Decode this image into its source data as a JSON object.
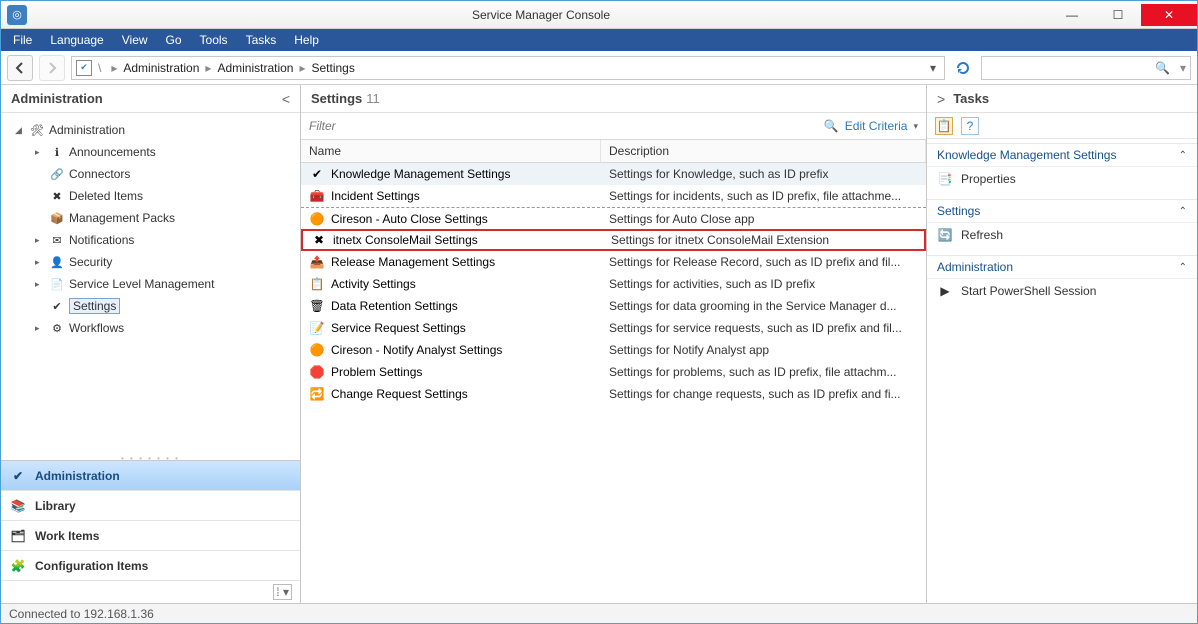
{
  "window": {
    "title": "Service Manager Console"
  },
  "menu": {
    "items": [
      "File",
      "Language",
      "View",
      "Go",
      "Tools",
      "Tasks",
      "Help"
    ]
  },
  "breadcrumb": {
    "segments": [
      "Administration",
      "Administration",
      "Settings"
    ]
  },
  "nav": {
    "title": "Administration",
    "tree": [
      {
        "label": "Administration",
        "depth": 0,
        "expander": "◢",
        "icon": "admin-root-icon"
      },
      {
        "label": "Announcements",
        "depth": 1,
        "expander": "▸",
        "icon": "announcement-icon"
      },
      {
        "label": "Connectors",
        "depth": 1,
        "expander": "",
        "icon": "connector-icon"
      },
      {
        "label": "Deleted Items",
        "depth": 1,
        "expander": "",
        "icon": "delete-icon"
      },
      {
        "label": "Management Packs",
        "depth": 1,
        "expander": "",
        "icon": "package-icon"
      },
      {
        "label": "Notifications",
        "depth": 1,
        "expander": "▸",
        "icon": "mail-icon"
      },
      {
        "label": "Security",
        "depth": 1,
        "expander": "▸",
        "icon": "user-icon"
      },
      {
        "label": "Service Level Management",
        "depth": 1,
        "expander": "▸",
        "icon": "sla-icon"
      },
      {
        "label": "Settings",
        "depth": 1,
        "expander": "",
        "icon": "settings-small-icon",
        "selected": true
      },
      {
        "label": "Workflows",
        "depth": 1,
        "expander": "▸",
        "icon": "workflow-icon"
      }
    ],
    "wunderbar": [
      {
        "label": "Administration",
        "active": true
      },
      {
        "label": "Library"
      },
      {
        "label": "Work Items"
      },
      {
        "label": "Configuration Items"
      }
    ]
  },
  "grid": {
    "title": "Settings",
    "count": "11",
    "filter_placeholder": "Filter",
    "edit_criteria": "Edit Criteria",
    "columns": [
      "Name",
      "Description"
    ],
    "rows": [
      {
        "name": "Knowledge Management Settings",
        "desc": "Settings for Knowledge, such as ID prefix",
        "selected": true
      },
      {
        "name": "Incident Settings",
        "desc": "Settings for incidents, such as ID prefix, file attachme..."
      },
      {
        "name": "Cireson - Auto Close Settings",
        "desc": "Settings for Auto Close app",
        "dashedTop": true
      },
      {
        "name": "itnetx ConsoleMail Settings",
        "desc": "Settings for itnetx ConsoleMail Extension",
        "highlight": true
      },
      {
        "name": "Release Management Settings",
        "desc": "Settings for Release Record, such as ID prefix and fil..."
      },
      {
        "name": "Activity Settings",
        "desc": "Settings for activities, such as ID prefix"
      },
      {
        "name": "Data Retention Settings",
        "desc": "Settings for data grooming in the Service Manager d..."
      },
      {
        "name": "Service Request Settings",
        "desc": "Settings for service requests, such as ID prefix and fil..."
      },
      {
        "name": "Cireson - Notify Analyst Settings",
        "desc": "Settings for Notify Analyst app"
      },
      {
        "name": "Problem Settings",
        "desc": "Settings for problems, such as ID prefix, file attachm..."
      },
      {
        "name": "Change Request Settings",
        "desc": "Settings for change requests, such as ID prefix and fi..."
      }
    ]
  },
  "tasks": {
    "title": "Tasks",
    "sections": [
      {
        "header": "Knowledge Management Settings",
        "items": [
          {
            "label": "Properties",
            "icon": "properties-icon"
          }
        ]
      },
      {
        "header": "Settings",
        "items": [
          {
            "label": "Refresh",
            "icon": "refresh-icon"
          }
        ]
      },
      {
        "header": "Administration",
        "items": [
          {
            "label": "Start PowerShell Session",
            "icon": "powershell-icon"
          }
        ]
      }
    ]
  },
  "status": {
    "text": "Connected to 192.168.1.36"
  }
}
